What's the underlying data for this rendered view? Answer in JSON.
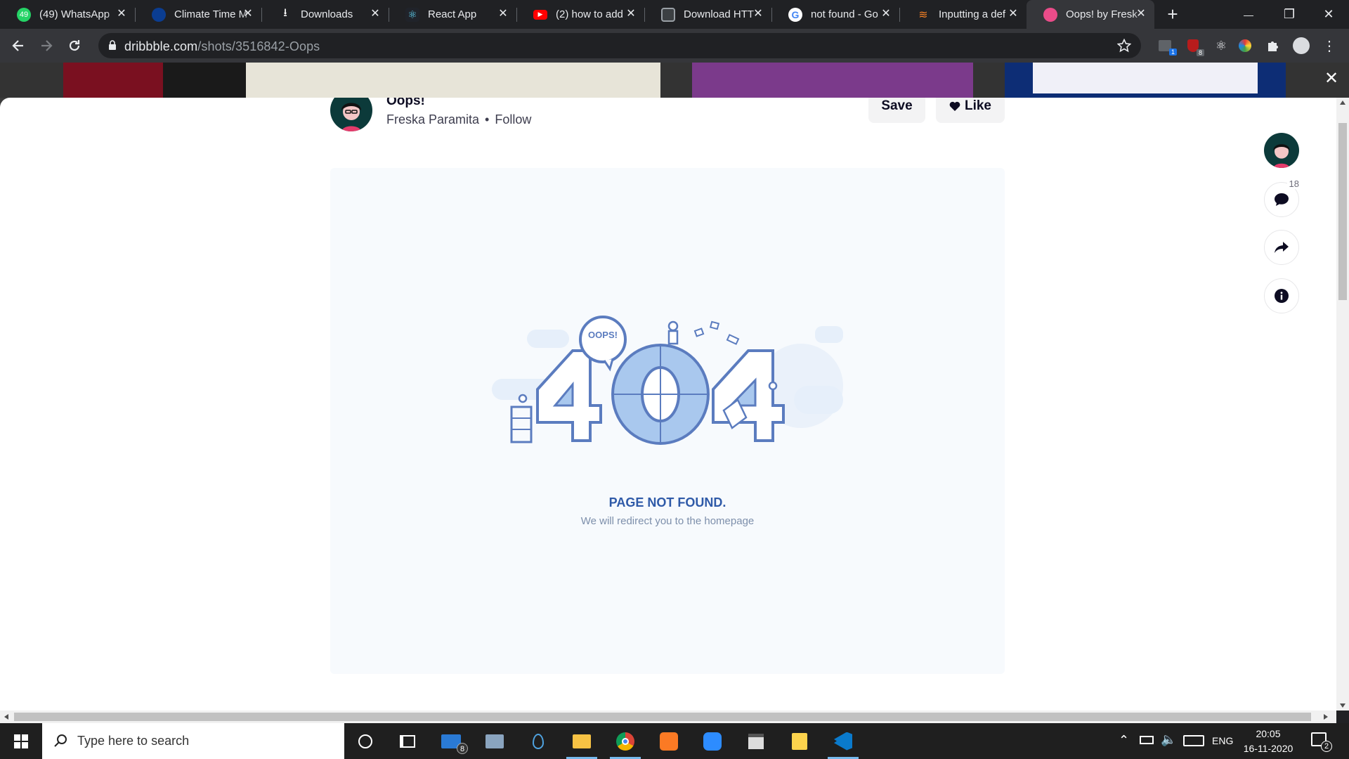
{
  "tabs": [
    {
      "title": "(49) WhatsApp",
      "icon": "whatsapp-icon",
      "color": "#25d366",
      "badge": "49"
    },
    {
      "title": "Climate Time M",
      "icon": "nasa-icon",
      "color": "#0b3d91",
      "badge": ""
    },
    {
      "title": "Downloads",
      "icon": "download-icon",
      "color": "#202124",
      "badge": ""
    },
    {
      "title": "React App",
      "icon": "react-icon",
      "color": "#20232a",
      "badge": ""
    },
    {
      "title": "(2) how to add",
      "icon": "youtube-icon",
      "color": "#ff0000",
      "badge": ""
    },
    {
      "title": "Download HTT",
      "icon": "page-icon",
      "color": "#444",
      "badge": ""
    },
    {
      "title": "not found - Go",
      "icon": "google-icon",
      "color": "#ffffff",
      "badge": ""
    },
    {
      "title": "Inputting a def",
      "icon": "stackoverflow-icon",
      "color": "#f48024",
      "badge": ""
    },
    {
      "title": "Oops! by Fresk",
      "icon": "dribbble-icon",
      "color": "#ea4c89",
      "badge": ""
    }
  ],
  "new_tab": "+",
  "window_controls": {
    "minimize": "—",
    "restore": "❐",
    "close": "✕"
  },
  "address_bar": {
    "domain": "dribbble.com",
    "path": "/shots/3516842-Oops"
  },
  "extensions": {
    "badge_1": "1",
    "badge_2": "8"
  },
  "shot": {
    "title": "Oops!",
    "author": "Freska Paramita",
    "separator": "•",
    "follow": "Follow",
    "save": "Save",
    "like": "Like",
    "comment_count": "18"
  },
  "illustration": {
    "number": "404",
    "bubble": "OOPS!",
    "headline": "PAGE NOT FOUND.",
    "subtext": "We will redirect you to the homepage"
  },
  "colors": {
    "accent_blue": "#5b7cbf",
    "light_blue": "#a9c8ee",
    "dribbble_pink": "#ea4c89",
    "taskbar": "#1f1f1f"
  },
  "taskbar": {
    "search_placeholder": "Type here to search",
    "mail_badge": "8",
    "lang": "ENG",
    "time": "20:05",
    "date": "16-11-2020",
    "notif_count": "2"
  }
}
